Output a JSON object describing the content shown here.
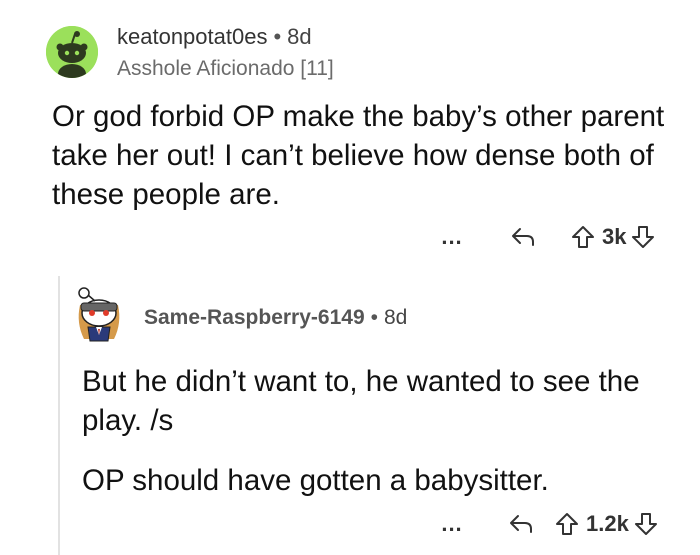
{
  "comment": {
    "username": "keatonpotat0es",
    "separator": "•",
    "age": "8d",
    "flair": "Asshole Aficionado [11]",
    "body": "Or god forbid OP make the baby’s other parent take her out! I can’t believe how dense both of these people are.",
    "actions": {
      "more_label": "...",
      "reply_icon": "reply-icon",
      "upvote_icon": "arrow-up-icon",
      "score": "3k",
      "downvote_icon": "arrow-down-icon"
    },
    "avatar_color": "#9be05b"
  },
  "reply": {
    "username": "Same-Raspberry-6149",
    "separator": "•",
    "age": "8d",
    "paragraphs": [
      "But he didn’t want to, he wanted to see the play. /s",
      "OP should have gotten a babysitter."
    ],
    "actions": {
      "more_label": "...",
      "reply_icon": "reply-icon",
      "upvote_icon": "arrow-up-icon",
      "score": "1.2k",
      "downvote_icon": "arrow-down-icon"
    }
  }
}
